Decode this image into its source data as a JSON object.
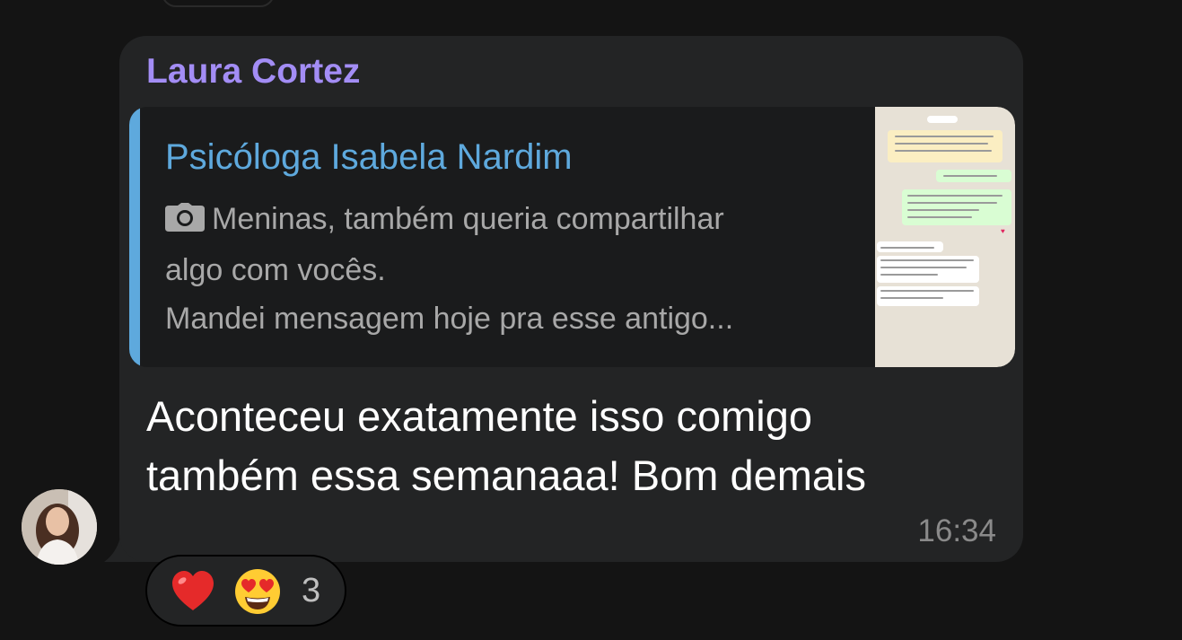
{
  "message": {
    "sender": "Laura Cortez",
    "reply": {
      "author": "Psicóloga Isabela Nardim",
      "media_icon": "camera-icon",
      "text_line1": "Meninas, também queria compartilhar",
      "text_line2": "algo com vocês.",
      "text_line3": "Mandei mensagem hoje pra esse antigo..."
    },
    "text_line1": "Aconteceu exatamente isso comigo",
    "text_line2": "também essa semanaaa! Bom demais",
    "time": "16:34"
  },
  "reactions": {
    "emojis": [
      "heart-icon",
      "heart-eyes-emoji"
    ],
    "count": "3"
  },
  "colors": {
    "sender": "#a38df5",
    "reply_accent": "#5ea9dd",
    "bubble": "#232425",
    "background": "#141414"
  }
}
